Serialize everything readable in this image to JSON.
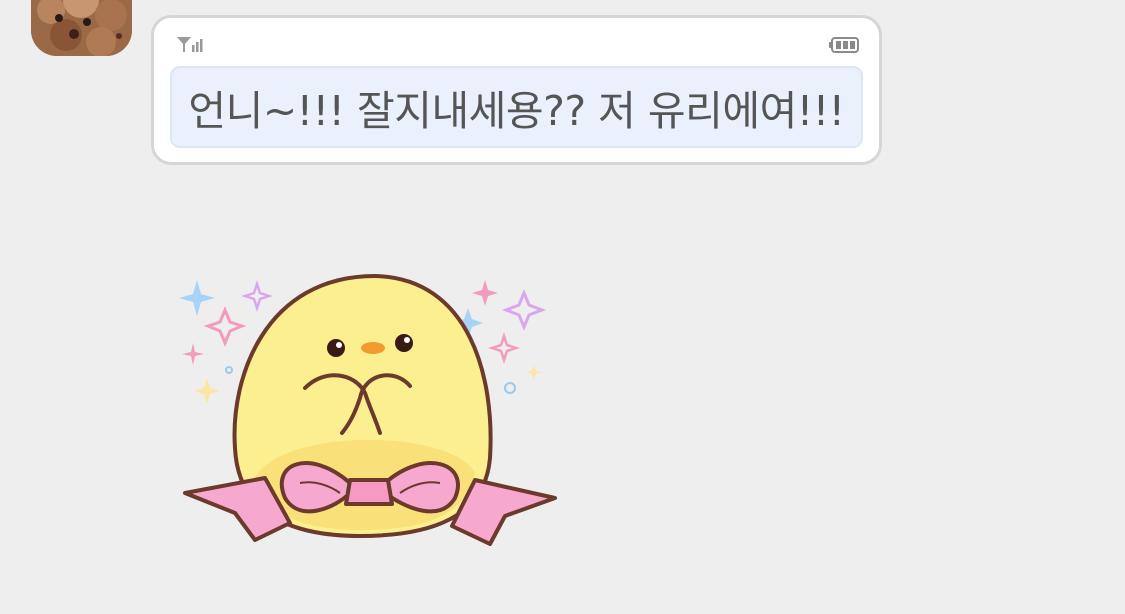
{
  "chat": {
    "message": {
      "text": "언니~!!! 잘지내세용?? 저 유리에여!!!",
      "status_icons": {
        "left": "signal-icon",
        "right": "battery-icon"
      }
    },
    "avatar": "avatar-photo",
    "sticker": "chick-with-bow-sticker"
  },
  "colors": {
    "background": "#eeeeee",
    "bubble_border": "#d6d6d6",
    "text_box_fill": "#eaf1fd",
    "text": "#555555",
    "chick": "#fcef8f",
    "ribbon": "#f7a8cf"
  }
}
